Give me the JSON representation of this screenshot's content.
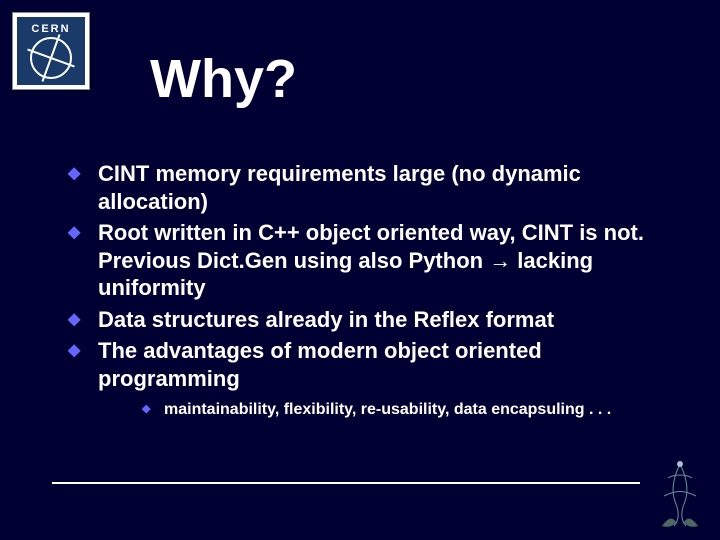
{
  "logo": {
    "text": "CERN"
  },
  "title": "Why?",
  "bullets": [
    {
      "text": "CINT memory requirements large (no dynamic allocation)"
    },
    {
      "text": "Root written in C++ object oriented way, CINT is not. Previous Dict.Gen using also Python → lacking uniformity"
    },
    {
      "text": "Data structures already in the Reflex format"
    },
    {
      "text": "The advantages of modern object oriented programming",
      "sub": [
        {
          "text": "maintainability, flexibility, re-usability, data encapsuling . . ."
        }
      ]
    }
  ]
}
